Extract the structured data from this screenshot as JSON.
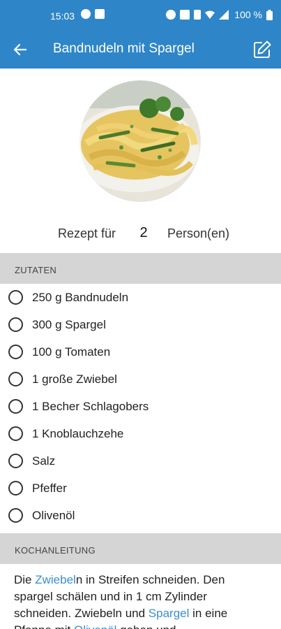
{
  "status_bar": {
    "time": "15:03",
    "battery_text": "100 %",
    "icons": [
      "notification-p-icon",
      "image-icon",
      "alarm-icon",
      "nfc-icon",
      "vibrate-icon",
      "wifi-icon",
      "signal-icon",
      "battery-icon"
    ]
  },
  "app_bar": {
    "title": "Bandnudeln mit Spargel",
    "back_icon": "arrow-left-icon",
    "edit_icon": "edit-icon"
  },
  "servings": {
    "label_before": "Rezept für",
    "count": "2",
    "label_after": "Person(en)"
  },
  "ingredients_section": {
    "header": "ZUTATEN",
    "items": [
      "250 g Bandnudeln",
      "300 g Spargel",
      "100 g Tomaten",
      "1 große Zwiebel",
      "1 Becher Schlagobers",
      "1 Knoblauchzehe",
      "Salz",
      "Pfeffer",
      "Olivenöl"
    ]
  },
  "instructions_section": {
    "header": "KOCHANLEITUNG",
    "segments": [
      {
        "text": "Die ",
        "link": false
      },
      {
        "text": "Zwiebel",
        "link": true
      },
      {
        "text": "n in Streifen schneiden. Den spargel schälen und in 1 cm Zylinder schneiden. Zwiebeln und ",
        "link": false
      },
      {
        "text": "Spargel",
        "link": true
      },
      {
        "text": " in eine Pfanne mit ",
        "link": false
      },
      {
        "text": "Olivenöl",
        "link": true
      },
      {
        "text": " geben und",
        "link": false
      }
    ]
  },
  "colors": {
    "primary": "#2e86c8",
    "section_bg": "#d5d5d5",
    "link": "#3a8dd0"
  }
}
